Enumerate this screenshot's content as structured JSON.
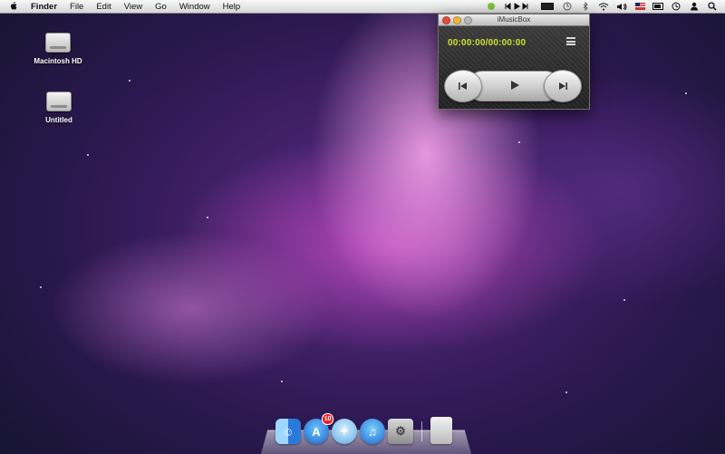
{
  "menubar": {
    "app_name": "Finder",
    "menus": [
      "File",
      "Edit",
      "View",
      "Go",
      "Window",
      "Help"
    ],
    "status_icons": [
      "imusicbox-status-icon",
      "transport-controls-icon",
      "battery-text-icon",
      "time-machine-icon",
      "bluetooth-icon",
      "wifi-icon",
      "volume-icon",
      "flag-icon",
      "battery-icon",
      "clock-icon",
      "user-icon",
      "spotlight-icon"
    ]
  },
  "desktop": {
    "icons": [
      {
        "label": "Macintosh HD"
      },
      {
        "label": "Untitled"
      }
    ]
  },
  "player": {
    "window_title": "iMusicBox",
    "timecode": "00:00:00/00:00:00"
  },
  "dock": {
    "items": [
      {
        "name": "Finder"
      },
      {
        "name": "App Store",
        "badge": "10"
      },
      {
        "name": "Safari"
      },
      {
        "name": "iTunes"
      },
      {
        "name": "System Preferences"
      },
      {
        "name": "Trash"
      }
    ]
  }
}
